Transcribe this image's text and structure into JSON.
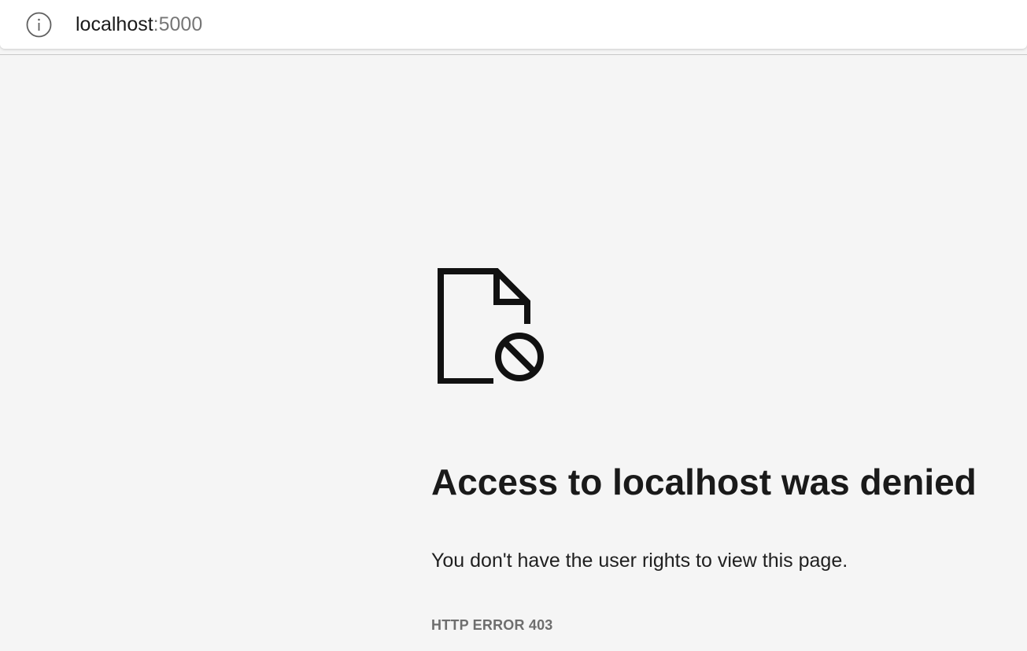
{
  "address_bar": {
    "host": "localhost",
    "port": ":5000",
    "icon": "info-icon"
  },
  "error_page": {
    "icon": "blocked-document-icon",
    "title": "Access to localhost was denied",
    "message": "You don't have the user rights to view this page.",
    "code": "HTTP ERROR 403"
  },
  "colors": {
    "page_background": "#f5f5f5",
    "address_bar_background": "#ffffff",
    "text_primary": "#1a1a1a",
    "text_secondary": "#6e6e6e",
    "port_text": "#767676"
  }
}
